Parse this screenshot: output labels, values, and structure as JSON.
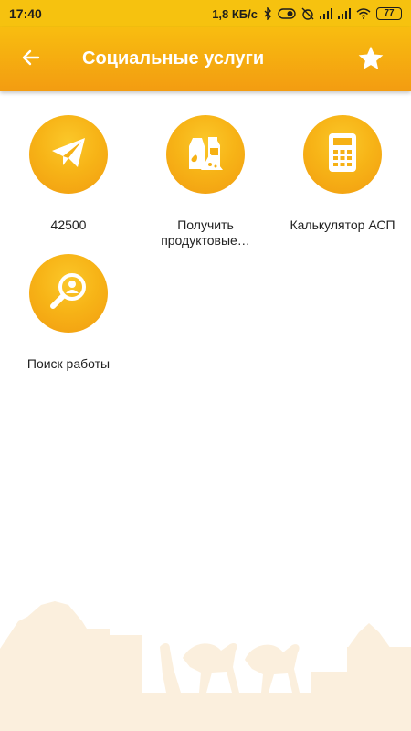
{
  "status_bar": {
    "time": "17:40",
    "speed": "1,8 КБ/с",
    "battery": "77",
    "icons": [
      "bluetooth-icon",
      "toggle-icon",
      "alarm-off-icon",
      "signal-icon",
      "signal-icon",
      "wifi-icon",
      "battery-icon"
    ]
  },
  "app_bar": {
    "title": "Социальные услуги",
    "back_icon": "arrow-left-icon",
    "favorite_icon": "star-icon"
  },
  "tiles": [
    {
      "label": "42500",
      "icon": "paper-plane-icon"
    },
    {
      "label": "Получить продуктовые…",
      "icon": "groceries-icon"
    },
    {
      "label": "Калькулятор АСП",
      "icon": "calculator-icon"
    },
    {
      "label": "Поиск работы",
      "icon": "job-search-icon"
    }
  ],
  "colors": {
    "status_bar": "#f6c20f",
    "app_bar_top": "#f8bd10",
    "app_bar_bottom": "#f39c11",
    "circle": "#f7b417",
    "background_art": "#fbefdd"
  }
}
